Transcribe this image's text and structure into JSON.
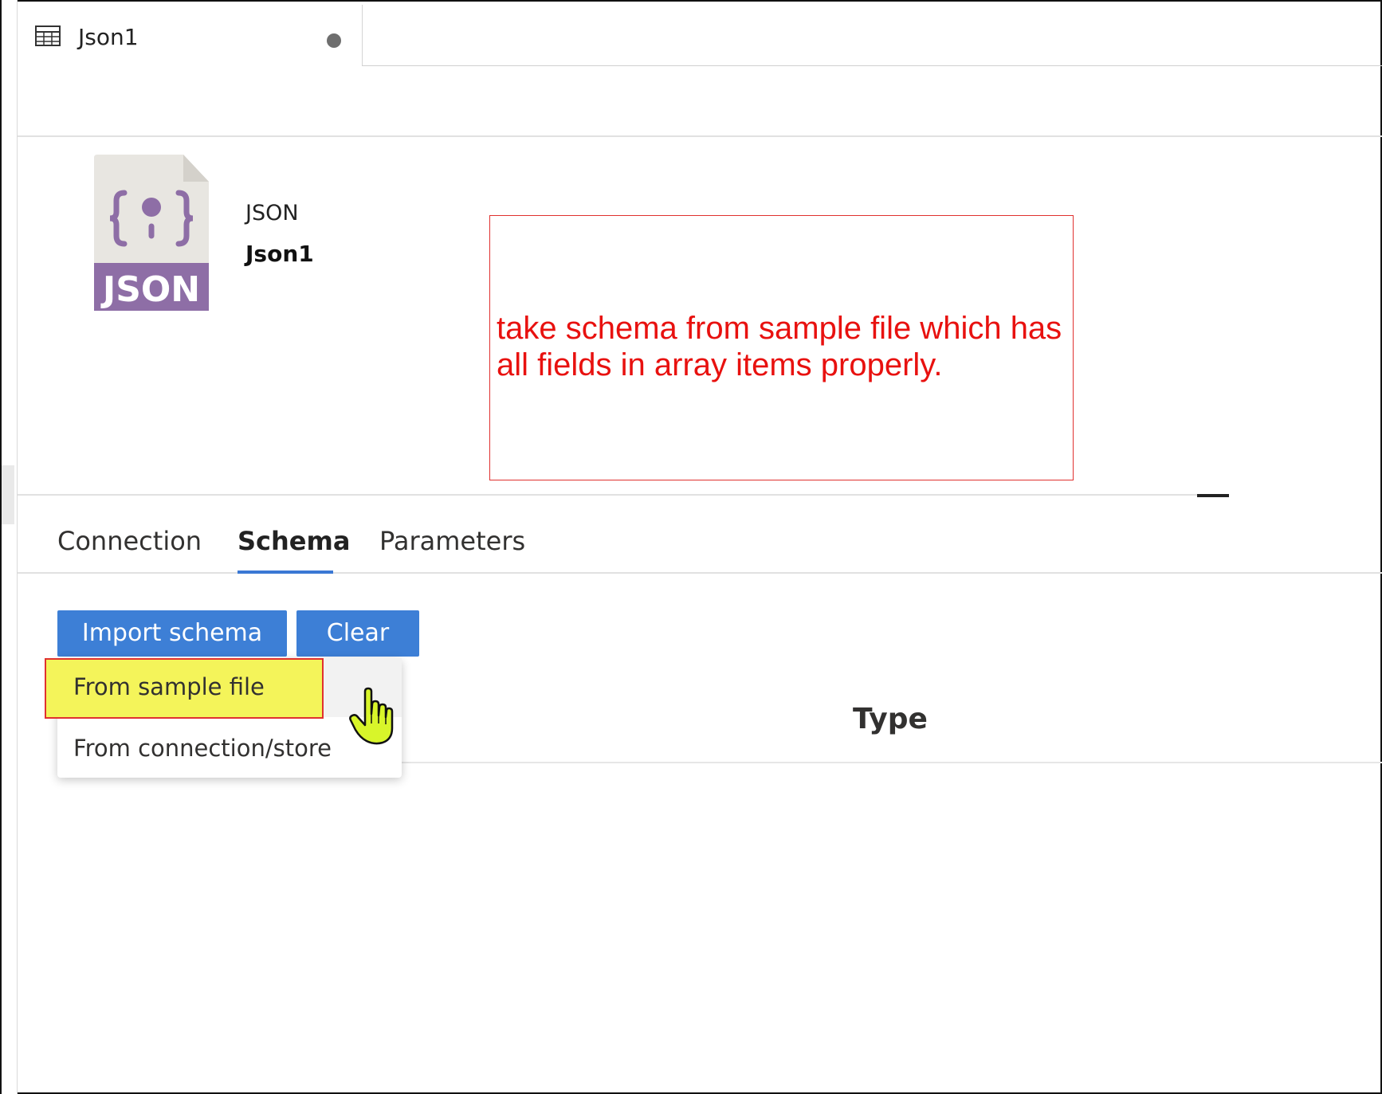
{
  "tab": {
    "title": "Json1",
    "icon": "table-icon",
    "status": "unsaved-dot"
  },
  "dataset": {
    "type": "JSON",
    "name": "Json1",
    "file_badge": "JSON",
    "icon": "json-file-icon"
  },
  "annotation": {
    "text": "take schema from sample file which has all fields in array items properly."
  },
  "property_tabs": [
    {
      "label": "Connection"
    },
    {
      "label": "Schema"
    },
    {
      "label": "Parameters"
    }
  ],
  "active_tab": "Schema",
  "toolbar": {
    "import_label": "Import schema",
    "clear_label": "Clear"
  },
  "import_menu": {
    "items": [
      {
        "label": "From sample file"
      },
      {
        "label": "From connection/store"
      }
    ]
  },
  "schema_table": {
    "type_header": "Type"
  },
  "colors": {
    "accent": "#3d7fd6",
    "annotation": "#e8110f",
    "json_purple": "#8e6ea6",
    "highlight": "#f4f45a"
  }
}
